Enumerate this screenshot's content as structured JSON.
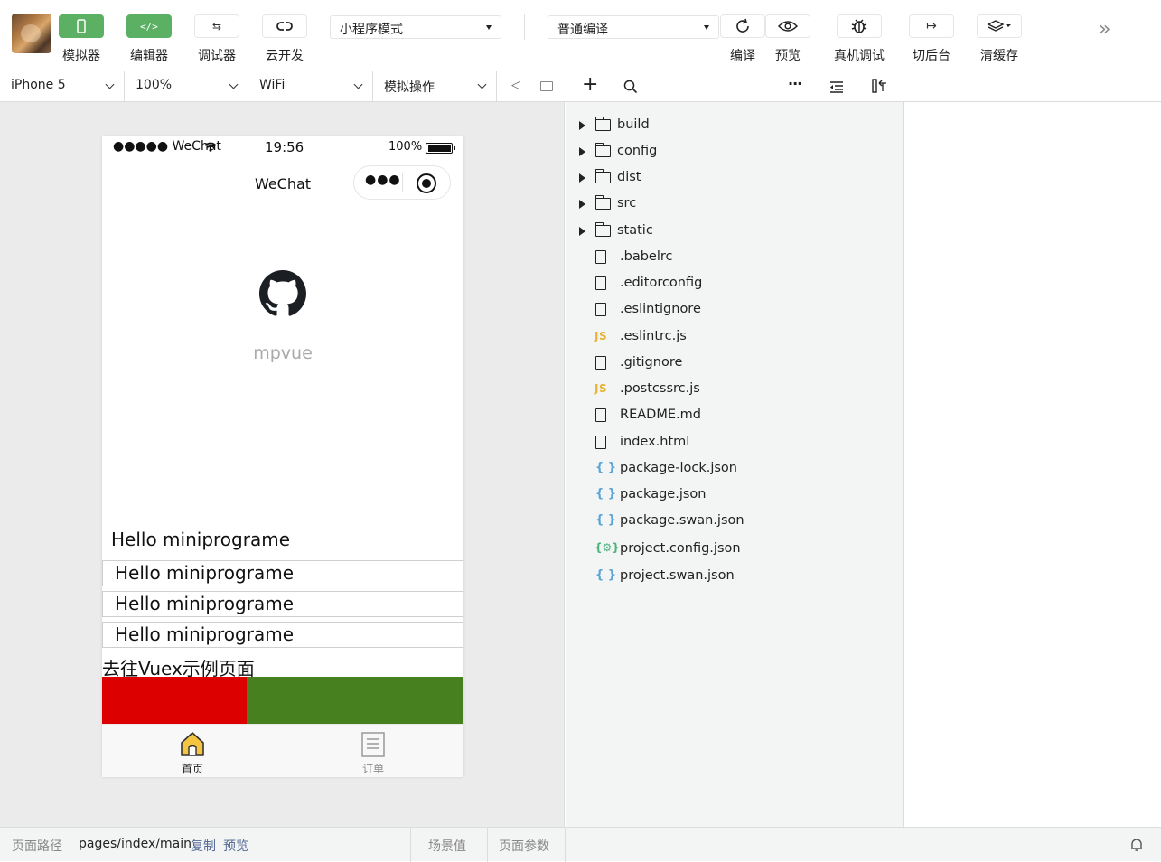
{
  "toolbar": {
    "buttons": [
      {
        "label": "模拟器"
      },
      {
        "label": "编辑器"
      },
      {
        "label": "调试器"
      },
      {
        "label": "云开发"
      }
    ],
    "mode_select": "小程序模式",
    "compile_select": "普通编译",
    "actions": [
      {
        "label": "编译"
      },
      {
        "label": "预览"
      },
      {
        "label": "真机调试"
      },
      {
        "label": "切后台"
      },
      {
        "label": "清缓存"
      }
    ]
  },
  "subbar": {
    "device": "iPhone 5",
    "zoom": "100%",
    "network": "WiFi",
    "operation": "模拟操作"
  },
  "phone": {
    "statusbar": {
      "carrier": "●●●●● WeChat",
      "time": "19:56",
      "battery": "100%"
    },
    "navbar_title": "WeChat",
    "logo_caption": "mpvue",
    "hello_text": "Hello miniprograme",
    "hello_rows": [
      "Hello miniprograme",
      "Hello miniprograme",
      "Hello miniprograme"
    ],
    "vuex_link": "去往Vuex示例页面",
    "colors": {
      "red_block": "#dd0000",
      "green_block": "#47801e"
    },
    "tabs": [
      {
        "label": "首页"
      },
      {
        "label": "订单"
      }
    ]
  },
  "explorer": {
    "folders": [
      "build",
      "config",
      "dist",
      "src",
      "static"
    ],
    "files": [
      {
        "name": ".babelrc",
        "type": "file"
      },
      {
        "name": ".editorconfig",
        "type": "file"
      },
      {
        "name": ".eslintignore",
        "type": "file"
      },
      {
        "name": ".eslintrc.js",
        "type": "js"
      },
      {
        "name": ".gitignore",
        "type": "file"
      },
      {
        "name": ".postcssrc.js",
        "type": "js"
      },
      {
        "name": "README.md",
        "type": "file"
      },
      {
        "name": "index.html",
        "type": "file"
      },
      {
        "name": "package-lock.json",
        "type": "json"
      },
      {
        "name": "package.json",
        "type": "json"
      },
      {
        "name": "package.swan.json",
        "type": "json"
      },
      {
        "name": "project.config.json",
        "type": "config"
      },
      {
        "name": "project.swan.json",
        "type": "json"
      }
    ]
  },
  "footer": {
    "path_label": "页面路径",
    "path_value": "pages/index/main",
    "copy": "复制",
    "preview": "预览",
    "scene": "场景值",
    "params": "页面参数"
  }
}
